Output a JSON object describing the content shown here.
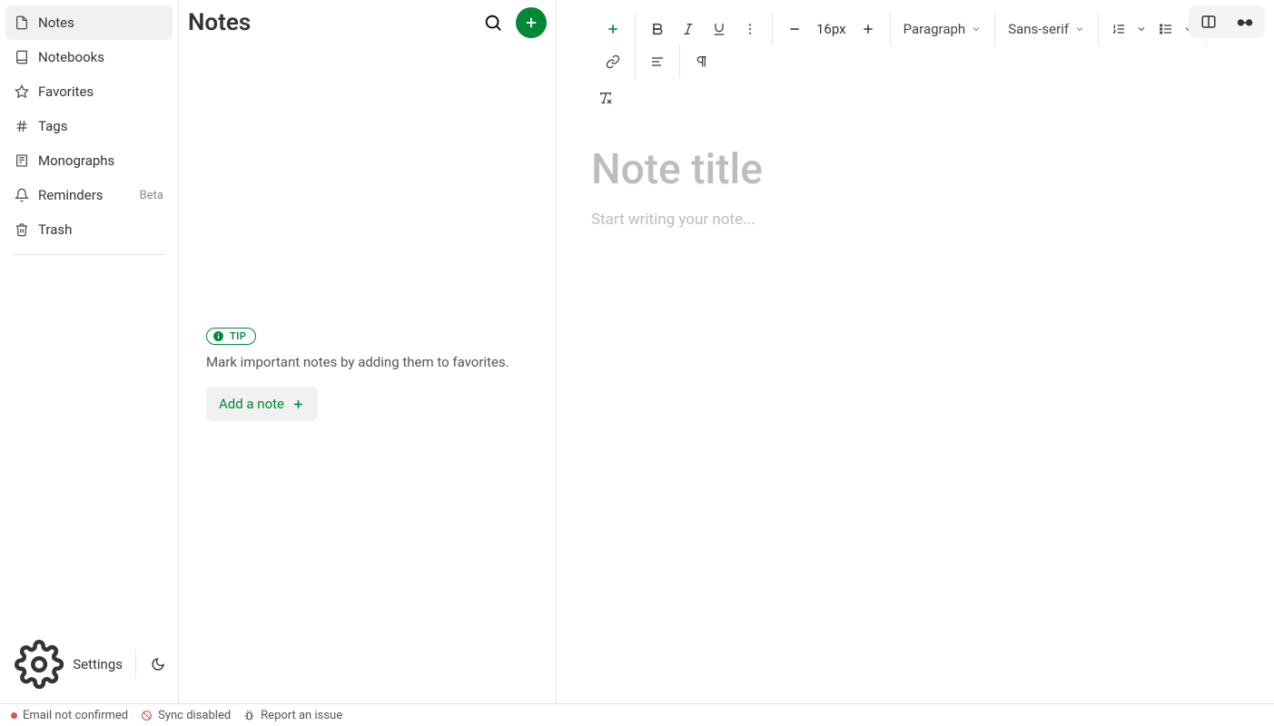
{
  "sidebar": {
    "items": [
      {
        "label": "Notes"
      },
      {
        "label": "Notebooks"
      },
      {
        "label": "Favorites"
      },
      {
        "label": "Tags"
      },
      {
        "label": "Monographs"
      },
      {
        "label": "Reminders",
        "badge": "Beta"
      },
      {
        "label": "Trash"
      }
    ],
    "settings_label": "Settings"
  },
  "list": {
    "title": "Notes",
    "tip_label": "TIP",
    "tip_text": "Mark important notes by adding them to favorites.",
    "add_note_label": "Add a note"
  },
  "editor": {
    "toolbar": {
      "font_size": "16px",
      "paragraph": "Paragraph",
      "font_family": "Sans-serif"
    },
    "title_placeholder": "Note title",
    "body_placeholder": "Start writing your note..."
  },
  "status": {
    "email": "Email not confirmed",
    "sync": "Sync disabled",
    "report": "Report an issue"
  }
}
